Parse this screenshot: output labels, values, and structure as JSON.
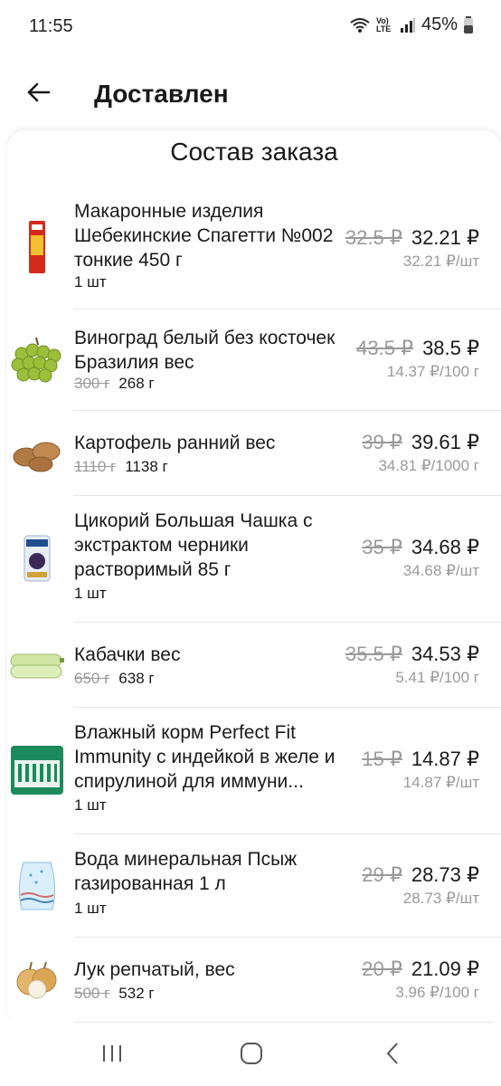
{
  "status_bar": {
    "time": "11:55",
    "network_label": "Vo) LTE",
    "battery": "45%"
  },
  "header": {
    "title": "Доставлен",
    "back_icon": "arrow-left-icon"
  },
  "sheet": {
    "title": "Состав заказа"
  },
  "items": [
    {
      "name": "Макаронные изделия Шебекинские Спагетти №002 тонкие 450 г",
      "qty_old": "",
      "qty": "1 шт",
      "old_price": "32.5 ₽",
      "price": "32.21 ₽",
      "unit_price": "32.21 ₽/шт",
      "image_icon": "spaghetti-pack-icon"
    },
    {
      "name": "Виноград белый без косточек Бразилия вес",
      "qty_old": "300 г",
      "qty": "268 г",
      "old_price": "43.5 ₽",
      "price": "38.5 ₽",
      "unit_price": "14.37 ₽/100 г",
      "image_icon": "grapes-icon"
    },
    {
      "name": "Картофель ранний вес",
      "qty_old": "1110 г",
      "qty": "1138 г",
      "old_price": "39 ₽",
      "price": "39.61 ₽",
      "unit_price": "34.81 ₽/1000 г",
      "image_icon": "potatoes-icon"
    },
    {
      "name": "Цикорий Большая Чашка с экстрактом черники растворимый 85 г",
      "qty_old": "",
      "qty": "1 шт",
      "old_price": "35 ₽",
      "price": "34.68 ₽",
      "unit_price": "34.68 ₽/шт",
      "image_icon": "chicory-pack-icon"
    },
    {
      "name": "Кабачки вес",
      "qty_old": "650 г",
      "qty": "638 г",
      "old_price": "35.5 ₽",
      "price": "34.53 ₽",
      "unit_price": "5.41 ₽/100 г",
      "image_icon": "zucchini-icon"
    },
    {
      "name": "Влажный корм Perfect Fit Immunity с индейкой в желе и спирулиной для иммуни...",
      "qty_old": "",
      "qty": "1 шт",
      "old_price": "15 ₽",
      "price": "14.87 ₽",
      "unit_price": "14.87 ₽/шт",
      "image_icon": "cat-food-pack-icon"
    },
    {
      "name": "Вода минеральная Псыж газированная 1 л",
      "qty_old": "",
      "qty": "1 шт",
      "old_price": "29 ₽",
      "price": "28.73 ₽",
      "unit_price": "28.73 ₽/шт",
      "image_icon": "water-bottle-icon"
    },
    {
      "name": "Лук репчатый, вес",
      "qty_old": "500 г",
      "qty": "532 г",
      "old_price": "20 ₽",
      "price": "21.09 ₽",
      "unit_price": "3.96 ₽/100 г",
      "image_icon": "onion-icon"
    }
  ],
  "nav": {
    "recent_icon": "recent-apps-icon",
    "home_icon": "home-icon",
    "back_icon": "back-chevron-icon"
  }
}
